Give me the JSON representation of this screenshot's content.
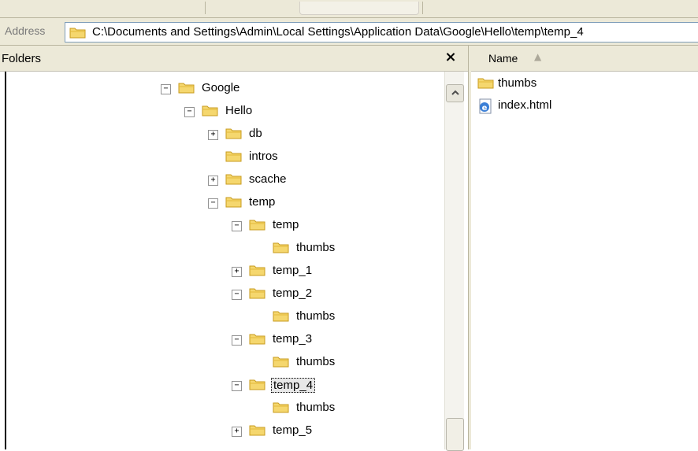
{
  "address": {
    "label": "Address",
    "path": "C:\\Documents and Settings\\Admin\\Local Settings\\Application Data\\Google\\Hello\\temp\\temp_4"
  },
  "folders_pane": {
    "title": "Folders",
    "close_symbol": "×",
    "tree": [
      {
        "label": "Google",
        "expander": "−",
        "level": 0
      },
      {
        "label": "Hello",
        "expander": "−",
        "level": 1
      },
      {
        "label": "db",
        "expander": "+",
        "level": 2
      },
      {
        "label": "intros",
        "expander": "",
        "level": 2
      },
      {
        "label": "scache",
        "expander": "+",
        "level": 2
      },
      {
        "label": "temp",
        "expander": "−",
        "level": 2
      },
      {
        "label": "temp",
        "expander": "−",
        "level": 3
      },
      {
        "label": "thumbs",
        "expander": "",
        "level": 4
      },
      {
        "label": "temp_1",
        "expander": "+",
        "level": 3
      },
      {
        "label": "temp_2",
        "expander": "−",
        "level": 3
      },
      {
        "label": "thumbs",
        "expander": "",
        "level": 4
      },
      {
        "label": "temp_3",
        "expander": "−",
        "level": 3
      },
      {
        "label": "thumbs",
        "expander": "",
        "level": 4
      },
      {
        "label": "temp_4",
        "expander": "−",
        "level": 3,
        "selected": true
      },
      {
        "label": "thumbs",
        "expander": "",
        "level": 4
      },
      {
        "label": "temp_5",
        "expander": "+",
        "level": 3
      }
    ]
  },
  "file_list": {
    "column_name": "Name",
    "sort_arrow": "▲",
    "items": [
      {
        "label": "thumbs",
        "icon": "folder-icon"
      },
      {
        "label": "index.html",
        "icon": "ie-html-icon"
      }
    ]
  },
  "colors": {
    "folder_fill": "#f5d76e",
    "folder_stroke": "#c89b1e",
    "chrome": "#ece9d8"
  }
}
